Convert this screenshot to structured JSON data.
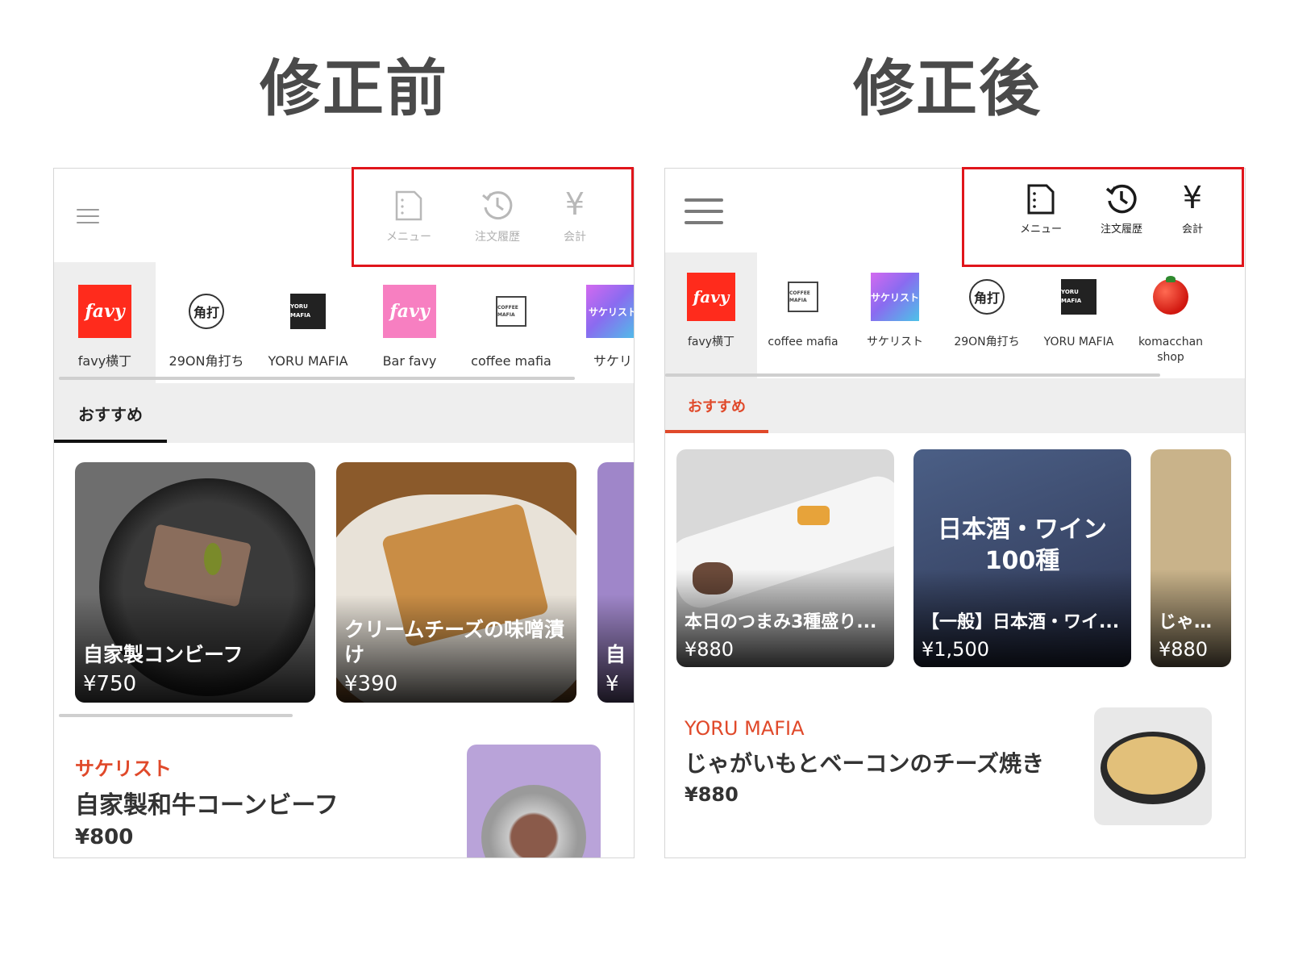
{
  "headings": {
    "before": "修正前",
    "after": "修正後"
  },
  "actions": {
    "menu": "メニュー",
    "history": "注文履歴",
    "checkout": "会計",
    "yen_symbol": "¥"
  },
  "colors": {
    "highlight": "#e0151b",
    "accent": "#e0492a",
    "favy_red": "#ff2b1c",
    "favy_pink": "#f77fc1"
  },
  "before": {
    "categories": [
      {
        "name": "favy横丁",
        "logo": "favy"
      },
      {
        "name": "29ON角打ち",
        "logo": "角打"
      },
      {
        "name": "YORU MAFIA",
        "logo": "YORU MAFIA"
      },
      {
        "name": "Bar favy",
        "logo": "favy"
      },
      {
        "name": "coffee mafia",
        "logo": "COFFEE MAFIA"
      },
      {
        "name": "サケリ",
        "logo": "サケリスト"
      }
    ],
    "tab": "おすすめ",
    "cards": [
      {
        "title": "自家製コンビーフ",
        "price": "¥750"
      },
      {
        "title": "クリームチーズの味噌漬け",
        "price": "¥390"
      },
      {
        "title": "自",
        "price": "¥"
      }
    ],
    "item": {
      "store": "サケリスト",
      "name": "自家製和牛コーンビーフ",
      "price": "¥800"
    }
  },
  "after": {
    "categories": [
      {
        "name": "favy横丁",
        "logo": "favy"
      },
      {
        "name": "coffee mafia",
        "logo": "COFFEE MAFIA"
      },
      {
        "name": "サケリスト",
        "logo": "サケリスト"
      },
      {
        "name": "29ON角打ち",
        "logo": "角打"
      },
      {
        "name": "YORU MAFIA",
        "logo": "YORU MAFIA"
      },
      {
        "name": "komacchan shop",
        "logo": "tomato"
      }
    ],
    "tab": "おすすめ",
    "cards": [
      {
        "title": "本日のつまみ3種盛り...",
        "price": "¥880"
      },
      {
        "title": "【一般】日本酒・ワイ...",
        "price": "¥1,500",
        "banner": "日本酒・ワイン100種"
      },
      {
        "title": "じゃがい",
        "price": "¥880"
      }
    ],
    "item": {
      "store": "YORU MAFIA",
      "name": "じゃがいもとベーコンのチーズ焼き",
      "price": "¥880"
    }
  }
}
